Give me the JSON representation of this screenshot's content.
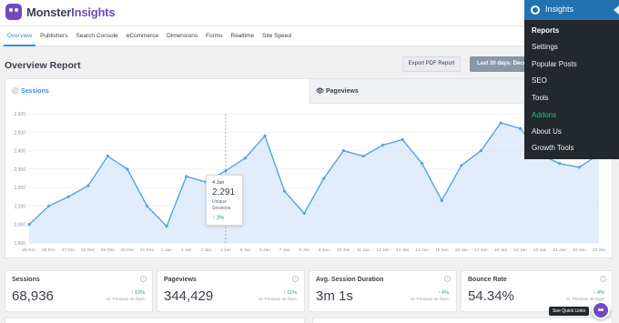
{
  "brand": {
    "name_prefix": "Monster",
    "name_suffix": "Insights"
  },
  "nav_tabs": [
    "Overview",
    "Publishers",
    "Search Console",
    "eCommerce",
    "Dimensions",
    "Forms",
    "Realtime",
    "Site Speed"
  ],
  "report": {
    "title": "Overview Report",
    "pdf_button": "Export PDF Report",
    "date_button": "Last 30 days: Decem"
  },
  "chart_tabs": {
    "sessions": "Sessions",
    "pageviews": "Pageviews"
  },
  "tooltip": {
    "date": "4 Jan",
    "value": "2,291",
    "label": "Unique Sessions",
    "change": "3%"
  },
  "admin_menu": {
    "header": "Insights",
    "items": [
      "Reports",
      "Settings",
      "Popular Posts",
      "SEO",
      "Tools",
      "Addons",
      "About Us",
      "Growth Tools"
    ]
  },
  "stats": [
    {
      "label": "Sessions",
      "value": "68,936",
      "change": "10%",
      "direction": "up",
      "prev": "vs. Previous 30 Days"
    },
    {
      "label": "Pageviews",
      "value": "344,429",
      "change": "11%",
      "direction": "up",
      "prev": "vs. Previous 30 Days"
    },
    {
      "label": "Avg. Session Duration",
      "value": "3m 1s",
      "change": "4%",
      "direction": "up",
      "prev": "vs. Previous 30 Days"
    },
    {
      "label": "Bounce Rate",
      "value": "54.34%",
      "change": "4%",
      "direction": "down",
      "prev": "vs. Previous 30 Days"
    }
  ],
  "quick_links": "See Quick Links",
  "colors": {
    "accent": "#338eef",
    "brand": "#6f4bbb",
    "positive": "#2ba36a",
    "menu_bg": "#23282d",
    "menu_active": "#2271b1",
    "addons": "#1ec57f"
  },
  "chart_data": {
    "type": "area",
    "title": "",
    "xlabel": "",
    "ylabel": "",
    "ylim": [
      1900,
      2600
    ],
    "yticks": [
      1900,
      2000,
      2100,
      2200,
      2300,
      2400,
      2500,
      2600
    ],
    "ytick_labels": [
      "1,900",
      "2,000",
      "2,100",
      "2,200",
      "2,300",
      "2,400",
      "2,500",
      "2,600"
    ],
    "categories": [
      "25 Dec",
      "26 Dec",
      "27 Dec",
      "28 Dec",
      "29 Dec",
      "30 Dec",
      "31 Dec",
      "1 Jan",
      "2 Jan",
      "3 Jan",
      "4 Jan",
      "5 Jan",
      "6 Jan",
      "7 Jan",
      "8 Jan",
      "9 Jan",
      "10 Jan",
      "11 Jan",
      "12 Jan",
      "13 Jan",
      "14 Jan",
      "15 Jan",
      "16 Jan",
      "17 Jan",
      "18 Jan",
      "19 Jan",
      "20 Jan",
      "21 Jan",
      "22 Jan",
      "23 Jan"
    ],
    "series": [
      {
        "values": [
          2000,
          2100,
          2150,
          2210,
          2370,
          2300,
          2100,
          1990,
          2260,
          2230,
          2291,
          2360,
          2480,
          2180,
          2060,
          2250,
          2400,
          2370,
          2430,
          2460,
          2330,
          2130,
          2320,
          2400,
          2550,
          2520,
          2380,
          2330,
          2310,
          2380
        ]
      }
    ],
    "grid": true
  }
}
